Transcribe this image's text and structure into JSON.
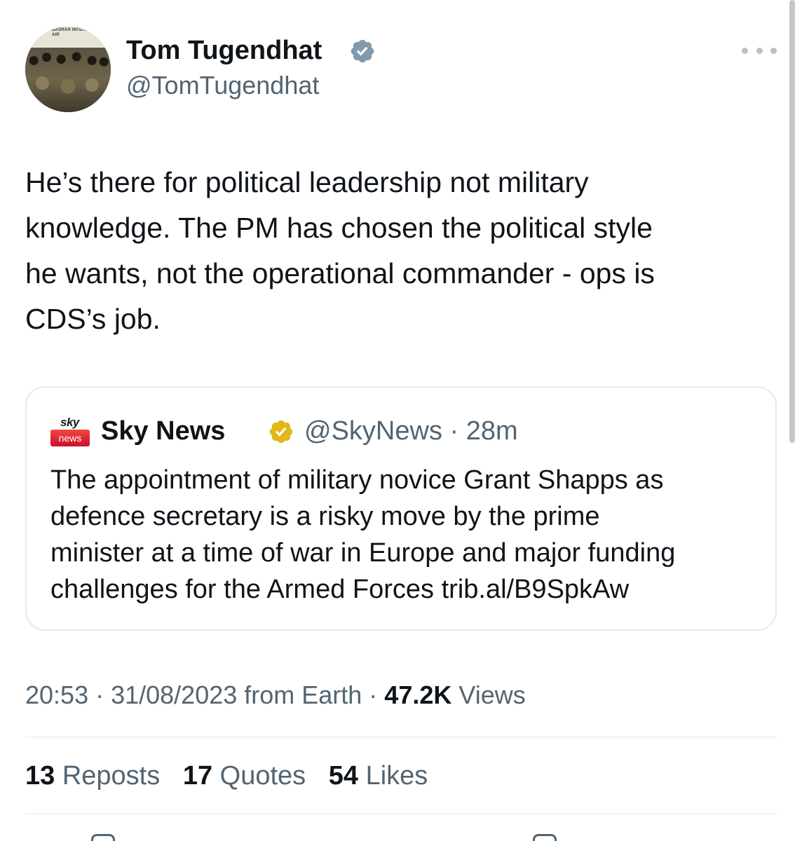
{
  "author": {
    "display_name": "Tom Tugendhat",
    "handle": "@TomTugendhat",
    "avatar_banner_text": "BASRAH INTERNATIONAL AIR"
  },
  "tweet": {
    "text": "He’s there for political leadership not military\nknowledge. The PM has chosen the political style\nhe wants, not the operational commander - ops is\nCDS’s job."
  },
  "quoted": {
    "logo_top": "sky",
    "logo_bottom": "news",
    "display_name": "Sky News",
    "handle_time": "@SkyNews · 28m",
    "text": "The appointment of military novice Grant Shapps as\ndefence secretary is a risky move by the prime\nminister at a time of war in Europe and major funding\nchallenges for the Armed Forces trib.al/B9SpkAw"
  },
  "meta": {
    "timestamp": "20:53 · 31/08/2023 from Earth · ",
    "views_count": "47.2K",
    "views_label": " Views"
  },
  "stats": {
    "reposts_count": "13",
    "reposts_label": " Reposts",
    "quotes_count": "17",
    "quotes_label": " Quotes",
    "likes_count": "54",
    "likes_label": " Likes"
  },
  "icons": {
    "more": "more-horizontal-icon",
    "author_verified": "verified-badge-gray",
    "quoted_verified": "verified-badge-gold"
  },
  "colors": {
    "text_primary": "#0f1419",
    "text_secondary": "#536471",
    "border": "#e6e9eb",
    "verified_gray": "#829aab",
    "verified_gold": "#e2b719",
    "sky_red": "#c8102e"
  }
}
